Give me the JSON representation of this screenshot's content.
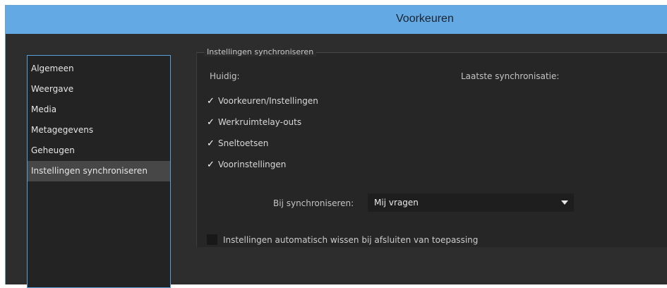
{
  "window": {
    "title": "Voorkeuren"
  },
  "sidebar": {
    "items": [
      {
        "label": "Algemeen"
      },
      {
        "label": "Weergave"
      },
      {
        "label": "Media"
      },
      {
        "label": "Metagegevens"
      },
      {
        "label": "Geheugen"
      },
      {
        "label": "Instellingen synchroniseren",
        "selected": true
      }
    ]
  },
  "sync_panel": {
    "group_title": "Instellingen synchroniseren",
    "current_label": "Huidig:",
    "last_sync_label": "Laatste synchronisatie:",
    "checkboxes": [
      {
        "label": "Voorkeuren/Instellingen",
        "checked": true
      },
      {
        "label": "Werkruimtelay-outs",
        "checked": true
      },
      {
        "label": "Sneltoetsen",
        "checked": true
      },
      {
        "label": "Voorinstellingen",
        "checked": true
      }
    ],
    "check_glyph": "✓",
    "on_sync_label": "Bij synchroniseren:",
    "on_sync_value": "Mij vragen",
    "auto_clear_label": "Instellingen automatisch wissen bij afsluiten van toepassing",
    "auto_clear_checked": false
  },
  "colors": {
    "titlebar": "#63a9e3",
    "background": "#2d2d2d",
    "selection": "#474747",
    "focus_border": "#5aa0d8"
  },
  "icons": {
    "check": "check-icon",
    "dropdown": "chevron-down-icon"
  }
}
